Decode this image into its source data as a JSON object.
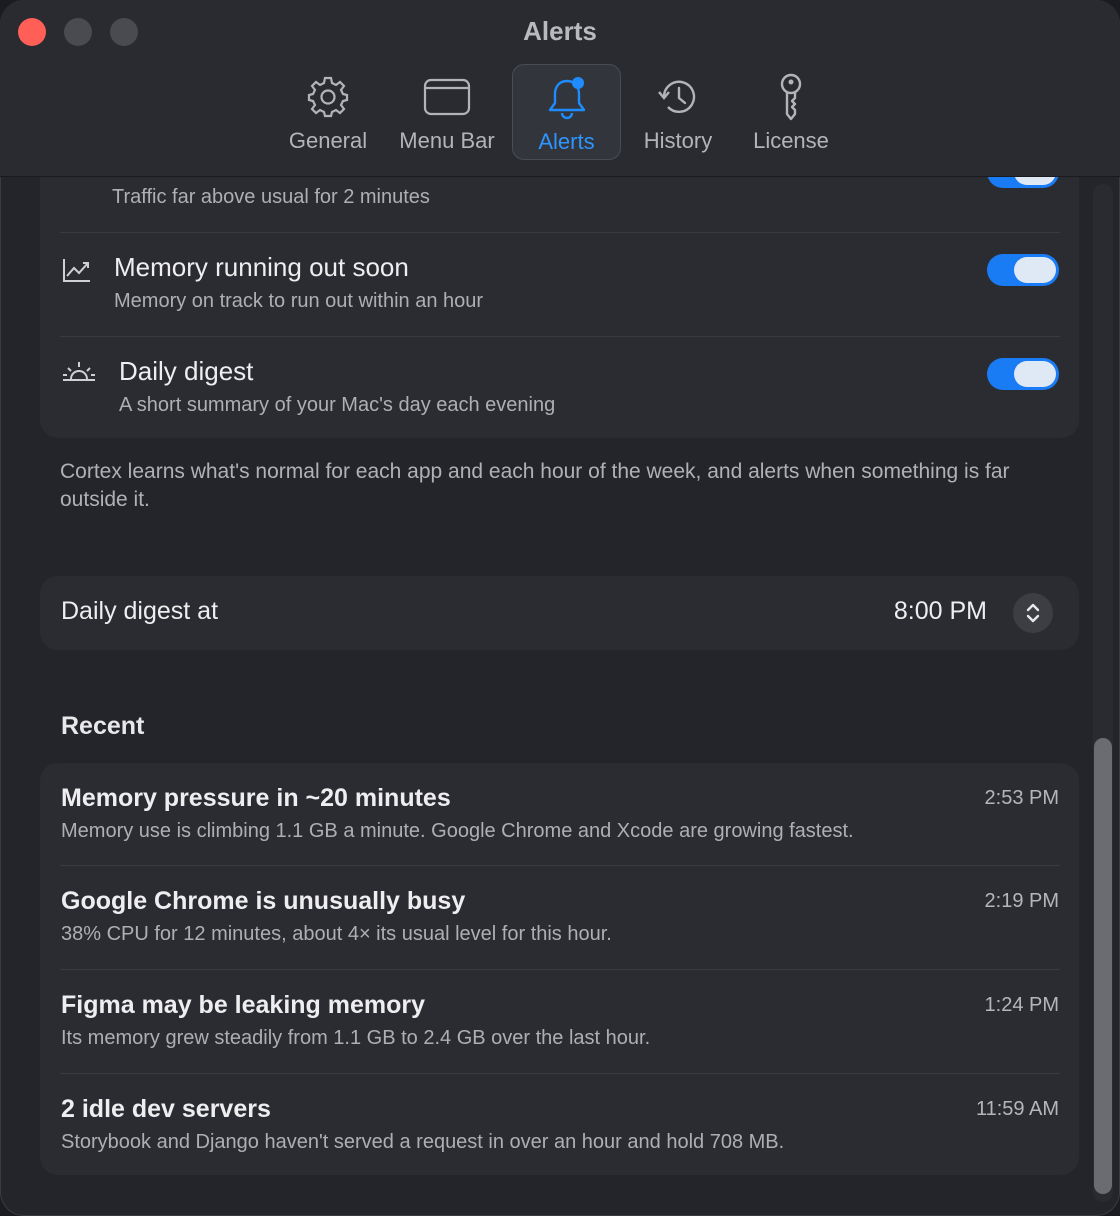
{
  "window": {
    "title": "Alerts"
  },
  "tabs": [
    {
      "label": "General",
      "icon": "gear-icon"
    },
    {
      "label": "Menu Bar",
      "icon": "menubar-icon"
    },
    {
      "label": "Alerts",
      "icon": "bell-icon"
    },
    {
      "label": "History",
      "icon": "history-icon"
    },
    {
      "label": "License",
      "icon": "key-icon"
    }
  ],
  "alert_rules": [
    {
      "subtitle": "Traffic far above usual for 2 minutes",
      "enabled": true
    },
    {
      "title": "Memory running out soon",
      "subtitle": "Memory on track to run out within an hour",
      "icon": "chart-line-icon",
      "enabled": true
    },
    {
      "title": "Daily digest",
      "subtitle": "A short summary of your Mac's day each evening",
      "icon": "sunrise-icon",
      "enabled": true
    }
  ],
  "note": "Cortex learns what's normal for each app and each hour of the week, and alerts when something is far outside it.",
  "digest": {
    "label": "Daily digest at",
    "time": "8:00 PM"
  },
  "recent": {
    "title": "Recent",
    "items": [
      {
        "title": "Memory pressure in ~20 minutes",
        "subtitle": "Memory use is climbing 1.1 GB a minute. Google Chrome and Xcode are growing fastest.",
        "time": "2:53 PM"
      },
      {
        "title": "Google Chrome is unusually busy",
        "subtitle": "38% CPU for 12 minutes, about 4× its usual level for this hour.",
        "time": "2:19 PM"
      },
      {
        "title": "Figma may be leaking memory",
        "subtitle": "Its memory grew steadily from 1.1 GB to 2.4 GB over the last hour.",
        "time": "1:24 PM"
      },
      {
        "title": "2 idle dev servers",
        "subtitle": "Storybook and Django haven't served a request in over an hour and hold 708 MB.",
        "time": "11:59 AM"
      }
    ]
  },
  "colors": {
    "accent": "#1a7cf5",
    "close": "#ff5f57"
  }
}
